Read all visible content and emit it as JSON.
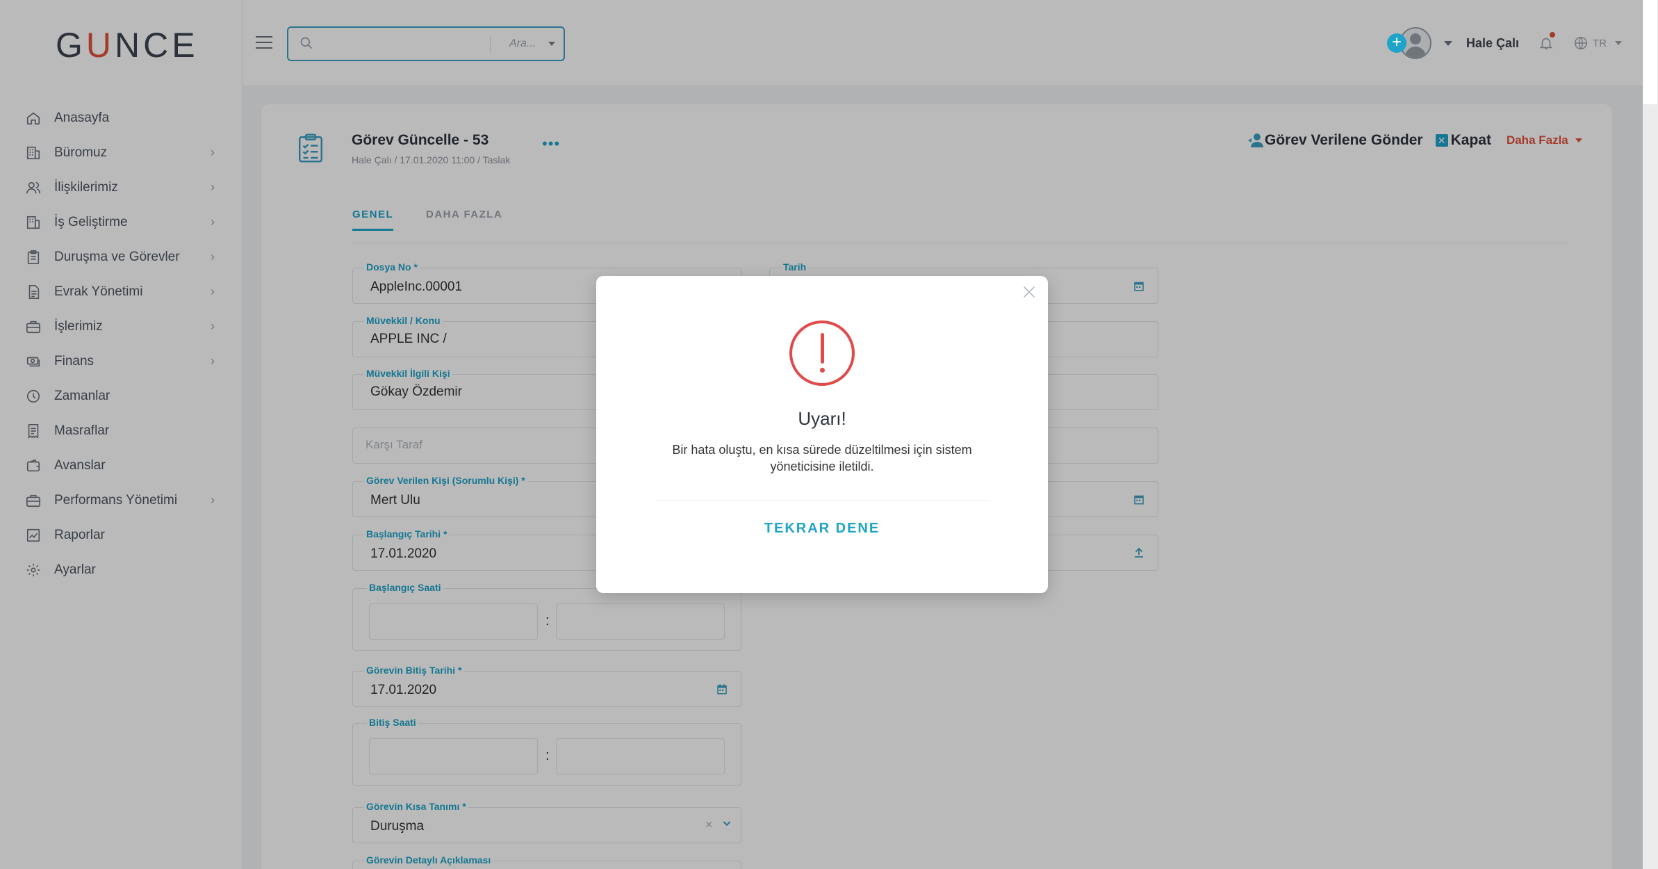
{
  "app": {
    "logo": "GÜNCE"
  },
  "sidebar": {
    "items": [
      {
        "label": "Anasayfa",
        "icon": "home-icon",
        "has_children": false
      },
      {
        "label": "Büromuz",
        "icon": "building-icon",
        "has_children": true
      },
      {
        "label": "İlişkilerimiz",
        "icon": "users-icon",
        "has_children": true
      },
      {
        "label": "İş Geliştirme",
        "icon": "building-icon",
        "has_children": true
      },
      {
        "label": "Duruşma ve Görevler",
        "icon": "clipboard-icon",
        "has_children": true
      },
      {
        "label": "Evrak Yönetimi",
        "icon": "document-icon",
        "has_children": true
      },
      {
        "label": "İşlerimiz",
        "icon": "briefcase-icon",
        "has_children": true
      },
      {
        "label": "Finans",
        "icon": "money-icon",
        "has_children": true
      },
      {
        "label": "Zamanlar",
        "icon": "clock-icon",
        "has_children": false
      },
      {
        "label": "Masraflar",
        "icon": "receipt-icon",
        "has_children": false
      },
      {
        "label": "Avanslar",
        "icon": "wallet-icon",
        "has_children": false
      },
      {
        "label": "Performans Yönetimi",
        "icon": "briefcase-icon",
        "has_children": true
      },
      {
        "label": "Raporlar",
        "icon": "chart-icon",
        "has_children": false
      },
      {
        "label": "Ayarlar",
        "icon": "gear-icon",
        "has_children": false
      }
    ]
  },
  "topbar": {
    "search_placeholder": "Ara...",
    "user_name": "Hale Çalı",
    "language": "TR"
  },
  "page": {
    "title": "Görev Güncelle - 53",
    "subtitle": "Hale Çalı / 17.01.2020 11:00 / Taslak",
    "actions": {
      "send": "Görev Verilene Gönder",
      "close": "Kapat",
      "more": "Daha Fazla"
    },
    "tabs": [
      "GENEL",
      "DAHA FAZLA"
    ]
  },
  "form": {
    "dosya_no": {
      "label": "Dosya No *",
      "value": "AppleInc.00001"
    },
    "tarih": {
      "label": "Tarih",
      "value": ""
    },
    "muvekkil": {
      "label": "Müvekkil / Konu",
      "value": "APPLE INC /"
    },
    "muvekkil_kisi": {
      "label": "Müvekkil İlgili Kişi",
      "value": "Gökay Özdemir"
    },
    "karsi_taraf": {
      "placeholder": "Karşı Taraf"
    },
    "sorumlu": {
      "label": "Görev Verilen Kişi (Sorumlu Kişi) *",
      "value": "Mert Ulu"
    },
    "baslangic_tarihi": {
      "label": "Başlangıç Tarihi *",
      "value": "17.01.2020"
    },
    "baslangic_saati": {
      "label": "Başlangıç Saati"
    },
    "bitis_tarihi": {
      "label": "Görevin Bitiş Tarihi *",
      "value": "17.01.2020"
    },
    "bitis_saati": {
      "label": "Bitiş Saati"
    },
    "kisa_tanim": {
      "label": "Görevin Kısa Tanımı *",
      "value": "Duruşma"
    },
    "detay": {
      "label": "Görevin Detaylı Açıklaması"
    },
    "time_separator": ":"
  },
  "modal": {
    "title": "Uyarı!",
    "message": "Bir hata oluştu, en kısa sürede düzeltilmesi için sistem yöneticisine iletildi.",
    "button": "TEKRAR DENE"
  },
  "colors": {
    "accent": "#1ea4c8",
    "danger": "#e04a4a",
    "brand_red": "#e0523c"
  }
}
